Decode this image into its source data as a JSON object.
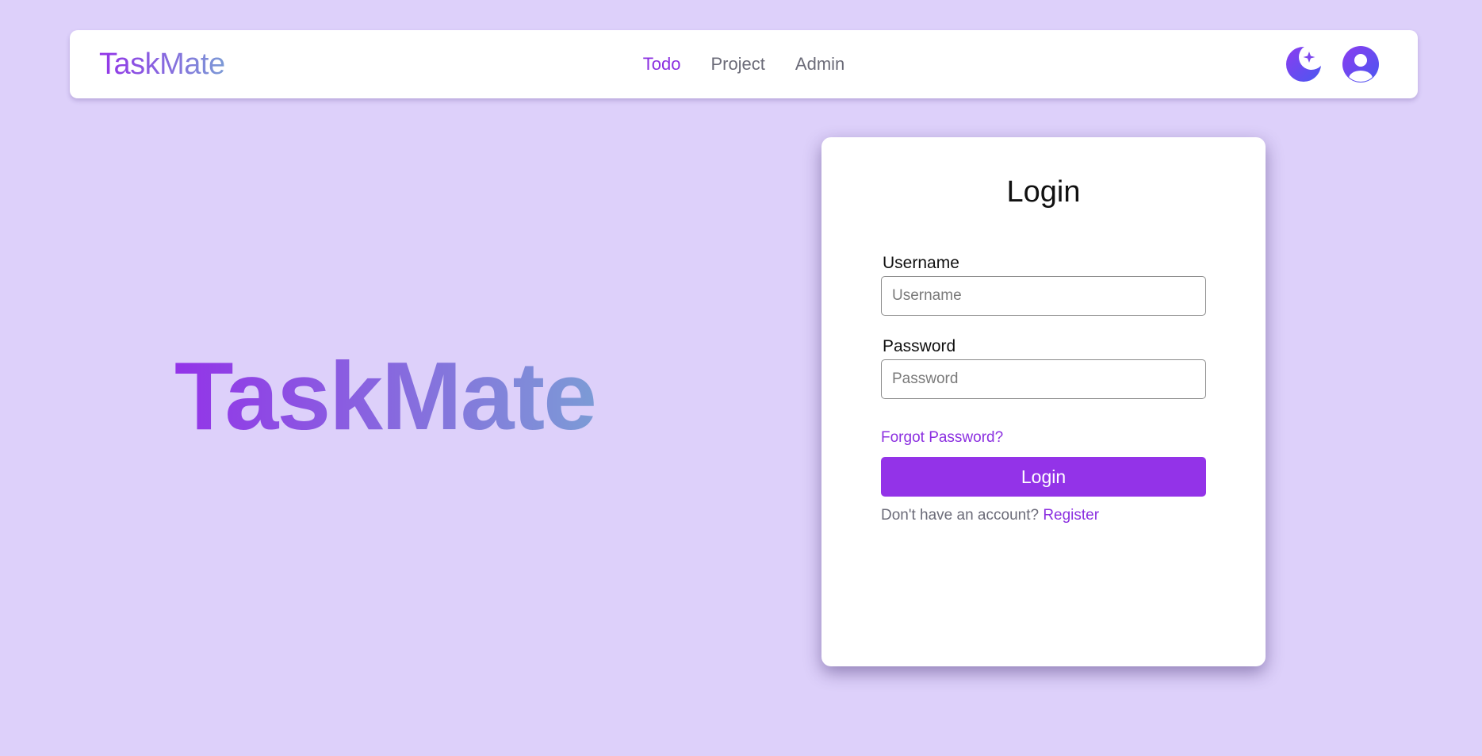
{
  "navbar": {
    "brand": "TaskMate",
    "links": [
      {
        "label": "Todo",
        "active": true
      },
      {
        "label": "Project",
        "active": false
      },
      {
        "label": "Admin",
        "active": false
      }
    ],
    "icons": {
      "theme": "moon-sparkle-icon",
      "profile": "user-circle-icon"
    }
  },
  "hero": {
    "title": "TaskMate"
  },
  "login": {
    "title": "Login",
    "username_label": "Username",
    "username_placeholder": "Username",
    "username_value": "",
    "password_label": "Password",
    "password_placeholder": "Password",
    "password_value": "",
    "forgot_link": "Forgot Password?",
    "submit_label": "Login",
    "register_prompt": "Don't have an account?",
    "register_link": "Register"
  },
  "colors": {
    "background": "#ddd0fa",
    "accent": "#9333e8",
    "link": "#8b2fe0",
    "icon_gradient_start": "#8b3cf0",
    "icon_gradient_end": "#4a58f0",
    "brand_gradient_start": "#9333e8",
    "brand_gradient_end": "#7c9bd6"
  }
}
